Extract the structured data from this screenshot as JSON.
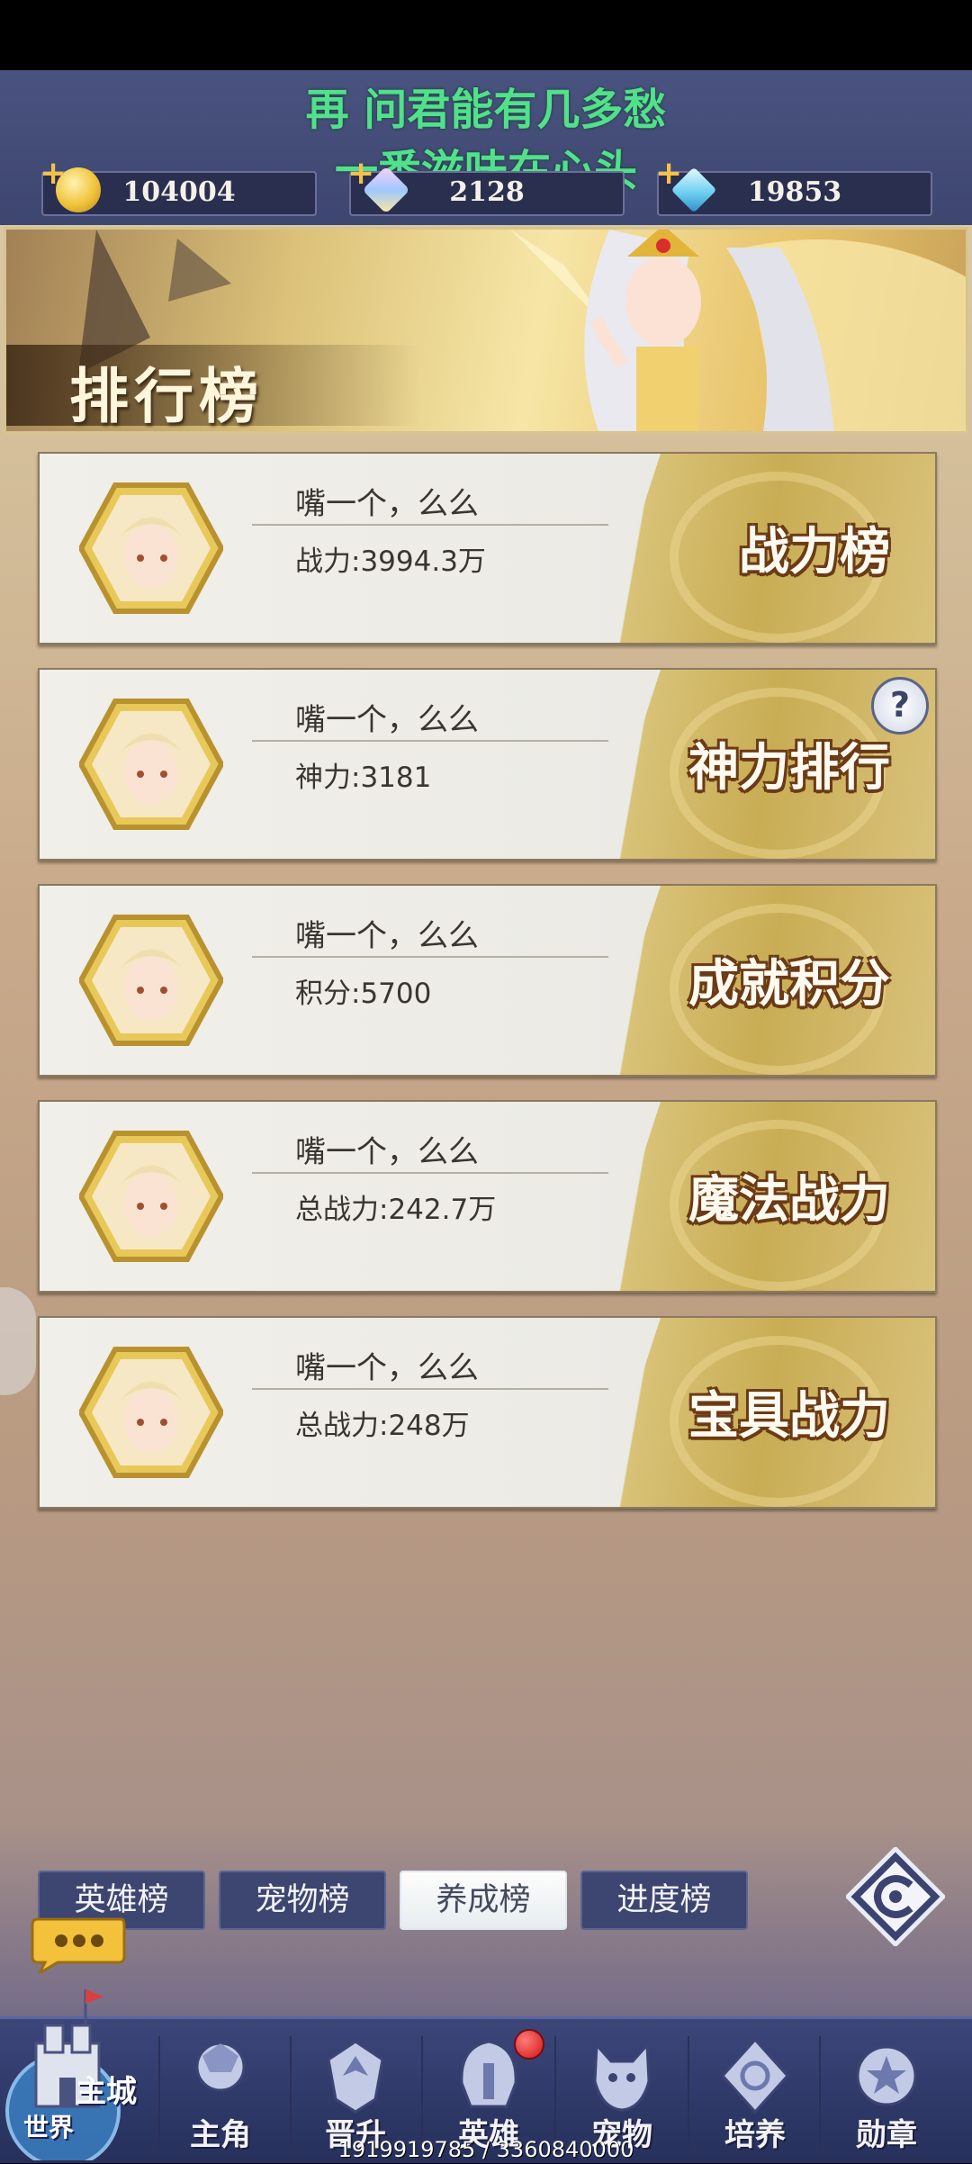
{
  "scroll_text": [
    "再 问君能有几多愁",
    "一番滋味在心头"
  ],
  "resources": [
    {
      "icon": "gold-coin-icon",
      "value": "104004"
    },
    {
      "icon": "crystal-gem-icon",
      "value": "2128"
    },
    {
      "icon": "diamond-icon",
      "value": "19853"
    }
  ],
  "banner": {
    "title": "排行榜"
  },
  "cards": [
    {
      "name": "嘴一个，么么",
      "stat": "战力:3994.3万",
      "label": "战力榜"
    },
    {
      "name": "嘴一个，么么",
      "stat": "神力:3181",
      "label": "神力排行"
    },
    {
      "name": "嘴一个，么么",
      "stat": "积分:5700",
      "label": "成就积分"
    },
    {
      "name": "嘴一个，么么",
      "stat": "总战力:242.7万",
      "label": "魔法战力"
    },
    {
      "name": "嘴一个，么么",
      "stat": "总战力:248万",
      "label": "宝具战力"
    }
  ],
  "help_symbol": "?",
  "tabs": [
    {
      "label": "英雄榜",
      "active": false
    },
    {
      "label": "宠物榜",
      "active": false
    },
    {
      "label": "养成榜",
      "active": true
    },
    {
      "label": "进度榜",
      "active": false
    }
  ],
  "main_city": {
    "label": "主城",
    "sub_label": "世界"
  },
  "nav": [
    {
      "label": "主角",
      "icon": "hero-profile-icon"
    },
    {
      "label": "晋升",
      "icon": "promotion-icon"
    },
    {
      "label": "英雄",
      "icon": "helmet-icon"
    },
    {
      "label": "宠物",
      "icon": "pet-icon"
    },
    {
      "label": "培养",
      "icon": "training-icon"
    },
    {
      "label": "勋章",
      "icon": "medal-icon"
    }
  ],
  "footer_id": "1919919785 / 3360840000",
  "colors": {
    "scroll_text": "#52e08c",
    "accent_gold": "#c9ad55",
    "nav_bg": "#3c467a",
    "badge_red": "#d11515"
  }
}
